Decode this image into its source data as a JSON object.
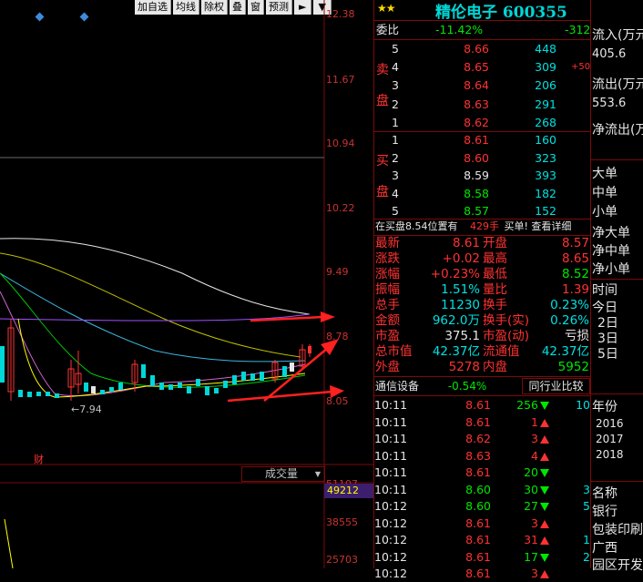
{
  "toolbar": {
    "items": [
      "加自选",
      "均线",
      "除权",
      "叠",
      "窗",
      "预测"
    ],
    "arrow_icon": "►",
    "dropdown_icon": "▼"
  },
  "price_axis": [
    "12.38",
    "11.67",
    "10.94",
    "10.22",
    "9.49",
    "8.78",
    "8.05"
  ],
  "chart": {
    "min_label": "←7.94",
    "marker_label": "财"
  },
  "volume": {
    "selector_label": "成交量",
    "axis": [
      "51107",
      "38555",
      "25703"
    ],
    "highlight_value": "49212"
  },
  "stock": {
    "stars": "★★",
    "name": "精伦电子 600355"
  },
  "weibi": {
    "label": "委比",
    "pct": "-11.42%",
    "diff": "-312"
  },
  "sell_label": [
    "卖",
    "盘"
  ],
  "buy_label": [
    "买",
    "盘"
  ],
  "sell": [
    {
      "lvl": "5",
      "price": "8.66",
      "vol": "448",
      "chg": ""
    },
    {
      "lvl": "4",
      "price": "8.65",
      "vol": "309",
      "chg": "+50"
    },
    {
      "lvl": "3",
      "price": "8.64",
      "vol": "206",
      "chg": ""
    },
    {
      "lvl": "2",
      "price": "8.63",
      "vol": "291",
      "chg": ""
    },
    {
      "lvl": "1",
      "price": "8.62",
      "vol": "268",
      "chg": ""
    }
  ],
  "buy": [
    {
      "lvl": "1",
      "price": "8.61",
      "vol": "160"
    },
    {
      "lvl": "2",
      "price": "8.60",
      "vol": "323"
    },
    {
      "lvl": "3",
      "price": "8.59",
      "vol": "393"
    },
    {
      "lvl": "4",
      "price": "8.58",
      "vol": "182"
    },
    {
      "lvl": "5",
      "price": "8.57",
      "vol": "152"
    }
  ],
  "buy_note": {
    "text": "在买盘8.54位置有",
    "vol": "429手",
    "tail": "买单! 查看详细"
  },
  "quote": [
    [
      "最新",
      "8.61",
      "开盘",
      "8.57"
    ],
    [
      "涨跌",
      "+0.02",
      "最高",
      "8.65"
    ],
    [
      "涨幅",
      "+0.23%",
      "最低",
      "8.52"
    ],
    [
      "振幅",
      "1.51%",
      "量比",
      "1.39"
    ],
    [
      "总手",
      "11230",
      "换手",
      "0.23%"
    ],
    [
      "金额",
      "962.0万",
      "换手(实)",
      "0.26%"
    ],
    [
      "市盈",
      "375.1",
      "市盈(动)",
      "亏损"
    ],
    [
      "总市值",
      "42.37亿",
      "流通值",
      "42.37亿"
    ],
    [
      "外盘",
      "5278",
      "内盘",
      "5952"
    ]
  ],
  "sector": {
    "name": "通信设备",
    "pct": "-0.54%",
    "compare": "同行业比较"
  },
  "ticks": [
    {
      "time": "10:11",
      "price": "8.61",
      "vol": "256",
      "dir": "down",
      "extra": "10"
    },
    {
      "time": "10:11",
      "price": "8.61",
      "vol": "1",
      "dir": "up",
      "extra": ""
    },
    {
      "time": "10:11",
      "price": "8.62",
      "vol": "3",
      "dir": "up",
      "extra": ""
    },
    {
      "time": "10:11",
      "price": "8.63",
      "vol": "4",
      "dir": "up",
      "extra": ""
    },
    {
      "time": "10:11",
      "price": "8.61",
      "vol": "20",
      "dir": "down",
      "extra": ""
    },
    {
      "time": "10:11",
      "price": "8.60",
      "vol": "30",
      "dir": "down",
      "extra": "3"
    },
    {
      "time": "10:12",
      "price": "8.60",
      "vol": "27",
      "dir": "down",
      "extra": "5"
    },
    {
      "time": "10:12",
      "price": "8.61",
      "vol": "3",
      "dir": "up",
      "extra": ""
    },
    {
      "time": "10:12",
      "price": "8.61",
      "vol": "31",
      "dir": "up",
      "extra": "1"
    },
    {
      "time": "10:12",
      "price": "8.61",
      "vol": "17",
      "dir": "down",
      "extra": "2"
    },
    {
      "time": "10:12",
      "price": "8.61",
      "vol": "3",
      "dir": "up",
      "extra": ""
    }
  ],
  "side": {
    "flow": [
      "流入(万元",
      "405.6",
      "流出(万元",
      "553.6",
      "净流出(万"
    ],
    "orders": [
      "大单",
      "中单",
      "小单",
      "净大单",
      "净中单",
      "净小单"
    ],
    "time": [
      "时间",
      "今日",
      "2日",
      "3日",
      "5日"
    ],
    "year": [
      "年份",
      "2016",
      "2017",
      "2018"
    ],
    "names": [
      "名称",
      "银行",
      "包装印刷",
      "广西",
      "园区开发"
    ]
  }
}
